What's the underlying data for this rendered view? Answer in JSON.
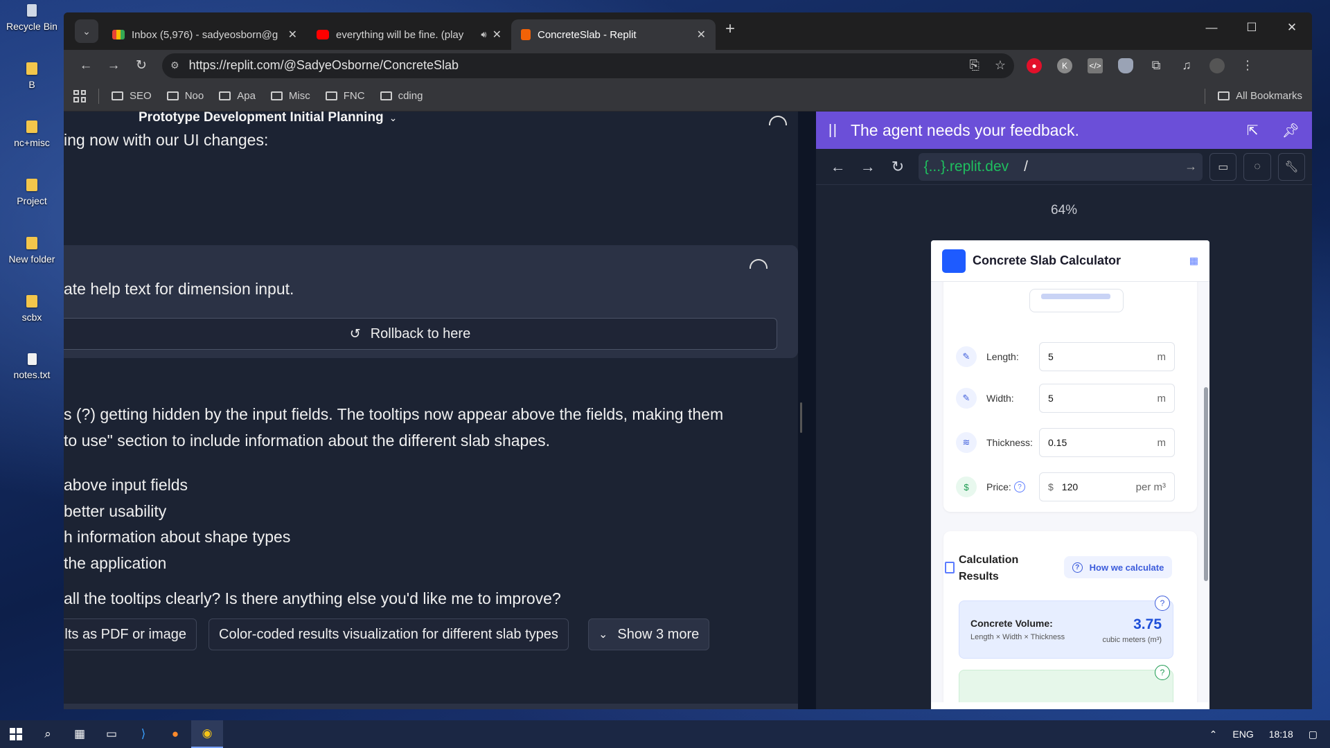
{
  "desktop": {
    "icons": [
      {
        "label": "Recycle Bin"
      },
      {
        "label": "B"
      },
      {
        "label": "nc+misc"
      },
      {
        "label": "Project"
      },
      {
        "label": "New folder"
      },
      {
        "label": "scbx"
      },
      {
        "label": "notes.txt"
      }
    ]
  },
  "browser": {
    "tabs": [
      {
        "title": "Inbox (5,976) - sadyeosborn@g",
        "icon": "gmail-icon"
      },
      {
        "title": "everything will be fine. (play",
        "icon": "youtube-icon"
      },
      {
        "title": "ConcreteSlab - Replit",
        "icon": "replit-icon",
        "active": true
      }
    ],
    "url": "https://replit.com/@SadyeOsborne/ConcreteSlab",
    "bookmarks": [
      "SEO",
      "Noo",
      "Apa",
      "Misc",
      "FNC",
      "cding"
    ],
    "all_bookmarks": "All Bookmarks"
  },
  "chat": {
    "project_title": "Prototype Development Initial Planning",
    "line1": "ing now with our UI changes:",
    "checkpoint_text": "ate help text for dimension input.",
    "rollback_label": "Rollback to here",
    "para1": "s (?) getting hidden by the input fields. The tooltips now appear above the fields, making them",
    "para2": " to use\" section to include information about the different slab shapes.",
    "bullets": [
      "above input fields",
      "better usability",
      "h information about shape types",
      " the application"
    ],
    "question": " all the tooltips clearly? Is there anything else you'd like me to improve?",
    "suggestions": [
      "ults as PDF or image",
      "Color-coded results visualization for different slab types"
    ],
    "show_more": "Show 3 more"
  },
  "preview": {
    "feedback_text": "The agent needs your feedback.",
    "url_domain": "{...}.replit.dev",
    "url_path": "/",
    "zoom": "64%",
    "app": {
      "title": "Concrete Slab Calculator",
      "fields": [
        {
          "label": "Length:",
          "value": "5",
          "unit": "m"
        },
        {
          "label": "Width:",
          "value": "5",
          "unit": "m"
        },
        {
          "label": "Thickness:",
          "value": "0.15",
          "unit": "m"
        },
        {
          "label": "Price:",
          "currency": "$",
          "value": "120",
          "unit": "per m³"
        }
      ],
      "results_title": "Calculation Results",
      "how_label": "How we calculate",
      "volume_label": "Concrete Volume:",
      "volume_sub": "Length × Width × Thickness",
      "volume_value": "3.75",
      "volume_unit": "cubic meters (m³)"
    }
  },
  "taskbar": {
    "lang": "ENG",
    "time": "18:18"
  },
  "colors": {
    "feedback_bar": "#6b4fd8",
    "replit_domain": "#1fbf5f",
    "app_accent": "#1e5bff"
  }
}
